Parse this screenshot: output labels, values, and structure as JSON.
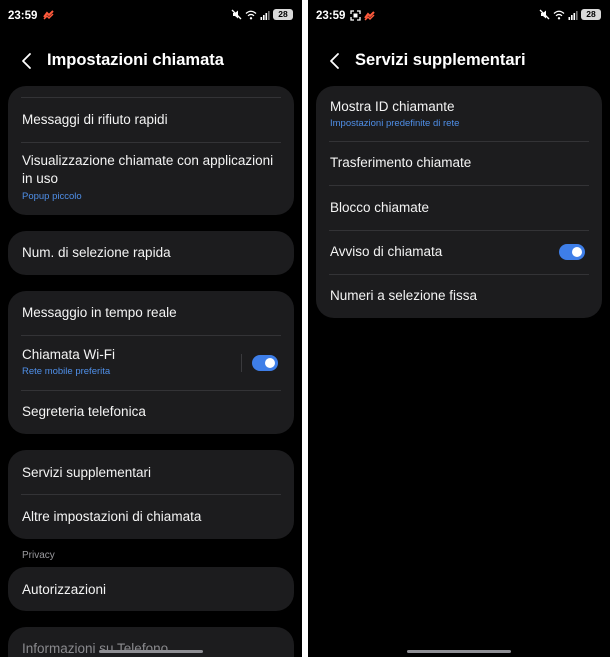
{
  "left_screen": {
    "status": {
      "time": "23:59",
      "battery": "28"
    },
    "header": {
      "title": "Impostazioni chiamata"
    },
    "card1": {
      "items": [
        {
          "label": "Messaggi di rifiuto rapidi"
        },
        {
          "label": "Visualizzazione chiamate con applicazioni in uso",
          "sub": "Popup piccolo"
        }
      ]
    },
    "card2": {
      "items": [
        {
          "label": "Num. di selezione rapida"
        }
      ]
    },
    "card3": {
      "items": [
        {
          "label": "Messaggio in tempo reale"
        },
        {
          "label": "Chiamata Wi-Fi",
          "sub": "Rete mobile preferita",
          "toggle": true
        },
        {
          "label": "Segreteria telefonica"
        }
      ]
    },
    "card4": {
      "items": [
        {
          "label": "Servizi supplementari"
        },
        {
          "label": "Altre impostazioni di chiamata"
        }
      ]
    },
    "section_privacy": "Privacy",
    "card5": {
      "items": [
        {
          "label": "Autorizzazioni"
        }
      ]
    },
    "card6": {
      "items": [
        {
          "label": "Informazioni su Telefono"
        }
      ]
    }
  },
  "right_screen": {
    "status": {
      "time": "23:59",
      "battery": "28"
    },
    "header": {
      "title": "Servizi supplementari"
    },
    "card1": {
      "items": [
        {
          "label": "Mostra ID chiamante",
          "sub": "Impostazioni predefinite di rete"
        },
        {
          "label": "Trasferimento chiamate"
        },
        {
          "label": "Blocco chiamate"
        },
        {
          "label": "Avviso di chiamata",
          "toggle": true
        },
        {
          "label": "Numeri a selezione fissa"
        }
      ]
    }
  },
  "colors": {
    "background": "#000000",
    "card": "#1c1c1e",
    "accent": "#3e7ee8",
    "subtext": "#4f8fe8",
    "notification_icon": "#ff5a3c"
  },
  "icons": {
    "back": "chevron-left-icon",
    "mute": "mute-icon",
    "wifi": "wifi-icon",
    "signal": "signal-icon",
    "battery": "battery-icon",
    "notification": "notification-badge-icon",
    "screenshot": "screenshot-icon"
  }
}
